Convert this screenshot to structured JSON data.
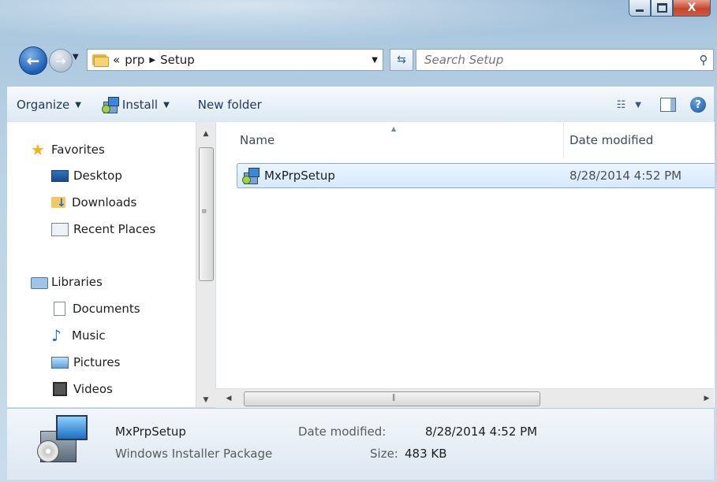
{
  "window": {
    "close_glyph": "X"
  },
  "address": {
    "overflow": "«",
    "crumbs": [
      "prp",
      "Setup"
    ]
  },
  "search": {
    "placeholder": "Search Setup"
  },
  "toolbar": {
    "organize": "Organize",
    "install": "Install",
    "new_folder": "New folder"
  },
  "navigation": {
    "favorites": "Favorites",
    "favorites_items": [
      "Desktop",
      "Downloads",
      "Recent Places"
    ],
    "libraries": "Libraries",
    "libraries_items": [
      "Documents",
      "Music",
      "Pictures",
      "Videos"
    ]
  },
  "columns": {
    "name": "Name",
    "date_modified": "Date modified"
  },
  "files": [
    {
      "name": "MxPrpSetup",
      "date": "8/28/2014 4:52 PM",
      "icon": "installer-package-icon",
      "selected": true
    }
  ],
  "details": {
    "name": "MxPrpSetup",
    "type": "Windows Installer Package",
    "date_label": "Date modified:",
    "date": "8/28/2014 4:52 PM",
    "size_label": "Size:",
    "size": "483 KB"
  }
}
